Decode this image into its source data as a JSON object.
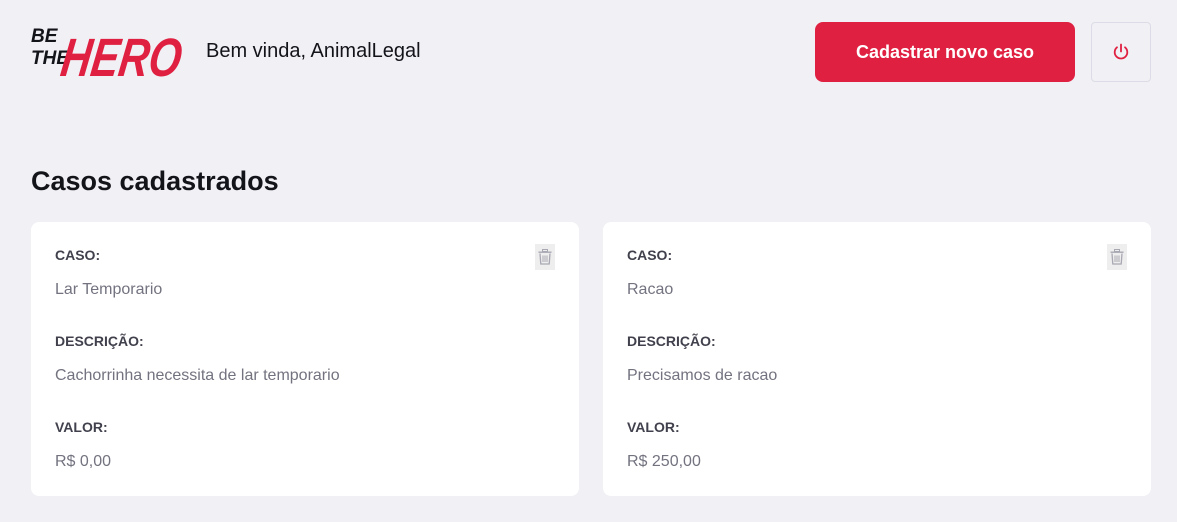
{
  "header": {
    "logo": {
      "line1": "BE",
      "line2": "THE",
      "word": "HERO"
    },
    "welcome": "Bem vinda, AnimalLegal",
    "new_case_label": "Cadastrar novo caso",
    "power_icon": "power-icon"
  },
  "section": {
    "title": "Casos cadastrados"
  },
  "labels": {
    "case": "CASO:",
    "description": "DESCRIÇÃO:",
    "value": "VALOR:"
  },
  "cases": [
    {
      "title": "Lar Temporario",
      "description": "Cachorrinha necessita de lar temporario",
      "value": "R$ 0,00"
    },
    {
      "title": "Racao",
      "description": "Precisamos de racao",
      "value": "R$ 250,00"
    }
  ],
  "colors": {
    "accent": "#e02041",
    "background": "#f0f0f5",
    "card": "#ffffff",
    "label": "#41414d",
    "muted": "#737380"
  }
}
